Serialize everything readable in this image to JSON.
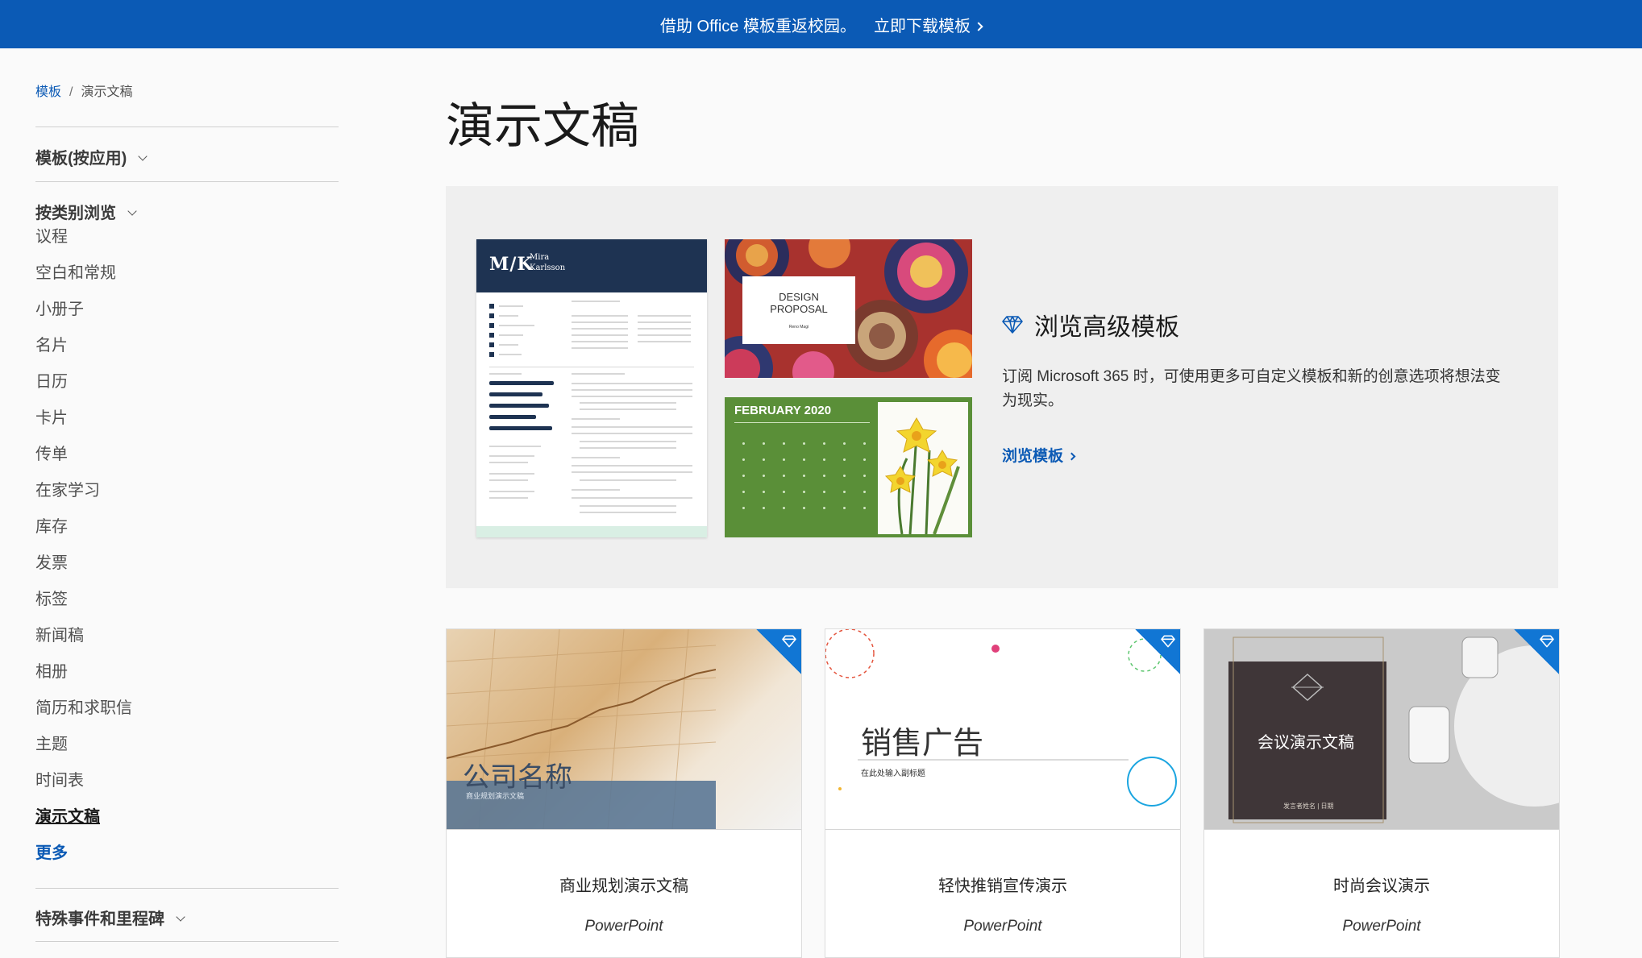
{
  "banner": {
    "text": "借助 Office 模板重返校园。",
    "link": "立即下载模板"
  },
  "breadcrumb": {
    "root": "模板",
    "separator": "/",
    "current": "演示文稿"
  },
  "sidebar": {
    "by_app": "模板(按应用)",
    "by_category": "按类别浏览",
    "categories": [
      "议程",
      "空白和常规",
      "小册子",
      "名片",
      "日历",
      "卡片",
      "传单",
      "在家学习",
      "库存",
      "发票",
      "标签",
      "新闻稿",
      "相册",
      "简历和求职信",
      "主题",
      "时间表",
      "演示文稿"
    ],
    "more": "更多",
    "events": "特殊事件和里程碑"
  },
  "page_title": "演示文稿",
  "hero": {
    "resume": {
      "monogram": "M/K",
      "name_line1": "Mira",
      "name_line2": "Karlsson"
    },
    "proposal": {
      "line1": "DESIGN",
      "line2": "PROPOSAL",
      "sub": "Reno Magi"
    },
    "calendar": {
      "title": "FEBRUARY 2020"
    },
    "premium": {
      "title": "浏览高级模板",
      "description": "订阅 Microsoft 365 时，可使用更多可自定义模板和新的创意选项将想法变为现实。",
      "link": "浏览模板",
      "icon": "diamond-icon"
    }
  },
  "templates": [
    {
      "name": "商业规划演示文稿",
      "app": "PowerPoint",
      "thumb_title": "公司名称",
      "thumb_sub": "商业规划演示文稿",
      "premium": true
    },
    {
      "name": "轻快推销宣传演示",
      "app": "PowerPoint",
      "thumb_title": "销售广告",
      "thumb_sub": "在此处输入副标题",
      "premium": true
    },
    {
      "name": "时尚会议演示",
      "app": "PowerPoint",
      "thumb_title": "会议演示文稿",
      "thumb_sub": "发言者姓名 | 日期",
      "premium": true
    }
  ],
  "colors": {
    "brand_blue": "#0b5ab5",
    "premium_corner": "#1176d4"
  }
}
